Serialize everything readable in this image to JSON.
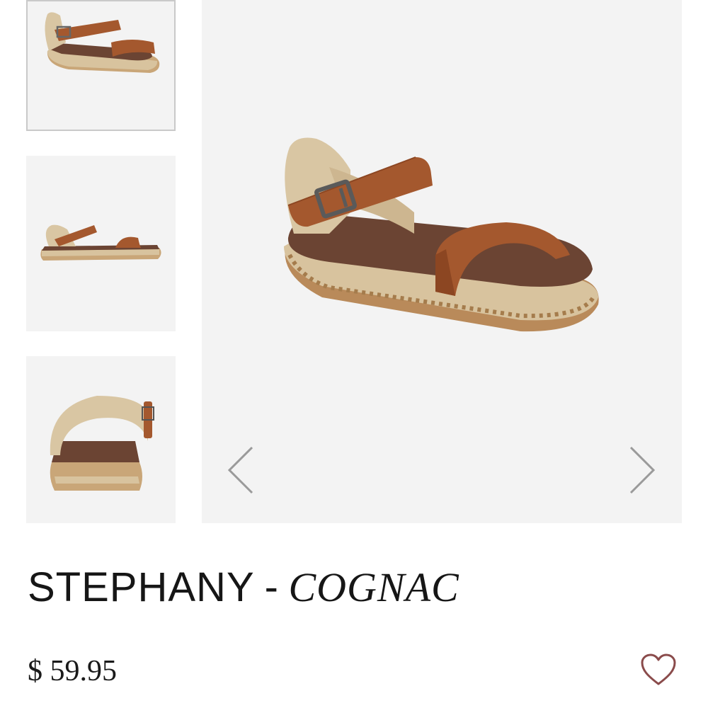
{
  "product": {
    "name": "STEPHANY",
    "separator": "-",
    "variant": "COGNAC",
    "price": "$ 59.95"
  },
  "gallery": {
    "thumbnails": [
      {
        "view": "angle-view",
        "selected": true
      },
      {
        "view": "side-view",
        "selected": false
      },
      {
        "view": "back-view",
        "selected": false
      }
    ],
    "main_view": "angle-view"
  },
  "icons": {
    "prev": "chevron-left-icon",
    "next": "chevron-right-icon",
    "wishlist": "heart-icon"
  },
  "colors": {
    "background": "#f3f3f3",
    "leather": "#a4582e",
    "insole": "#6b4433",
    "jute": "#d9c6a3",
    "wishlist_heart": "#8a4b4b",
    "arrow": "#9a9a9a"
  }
}
